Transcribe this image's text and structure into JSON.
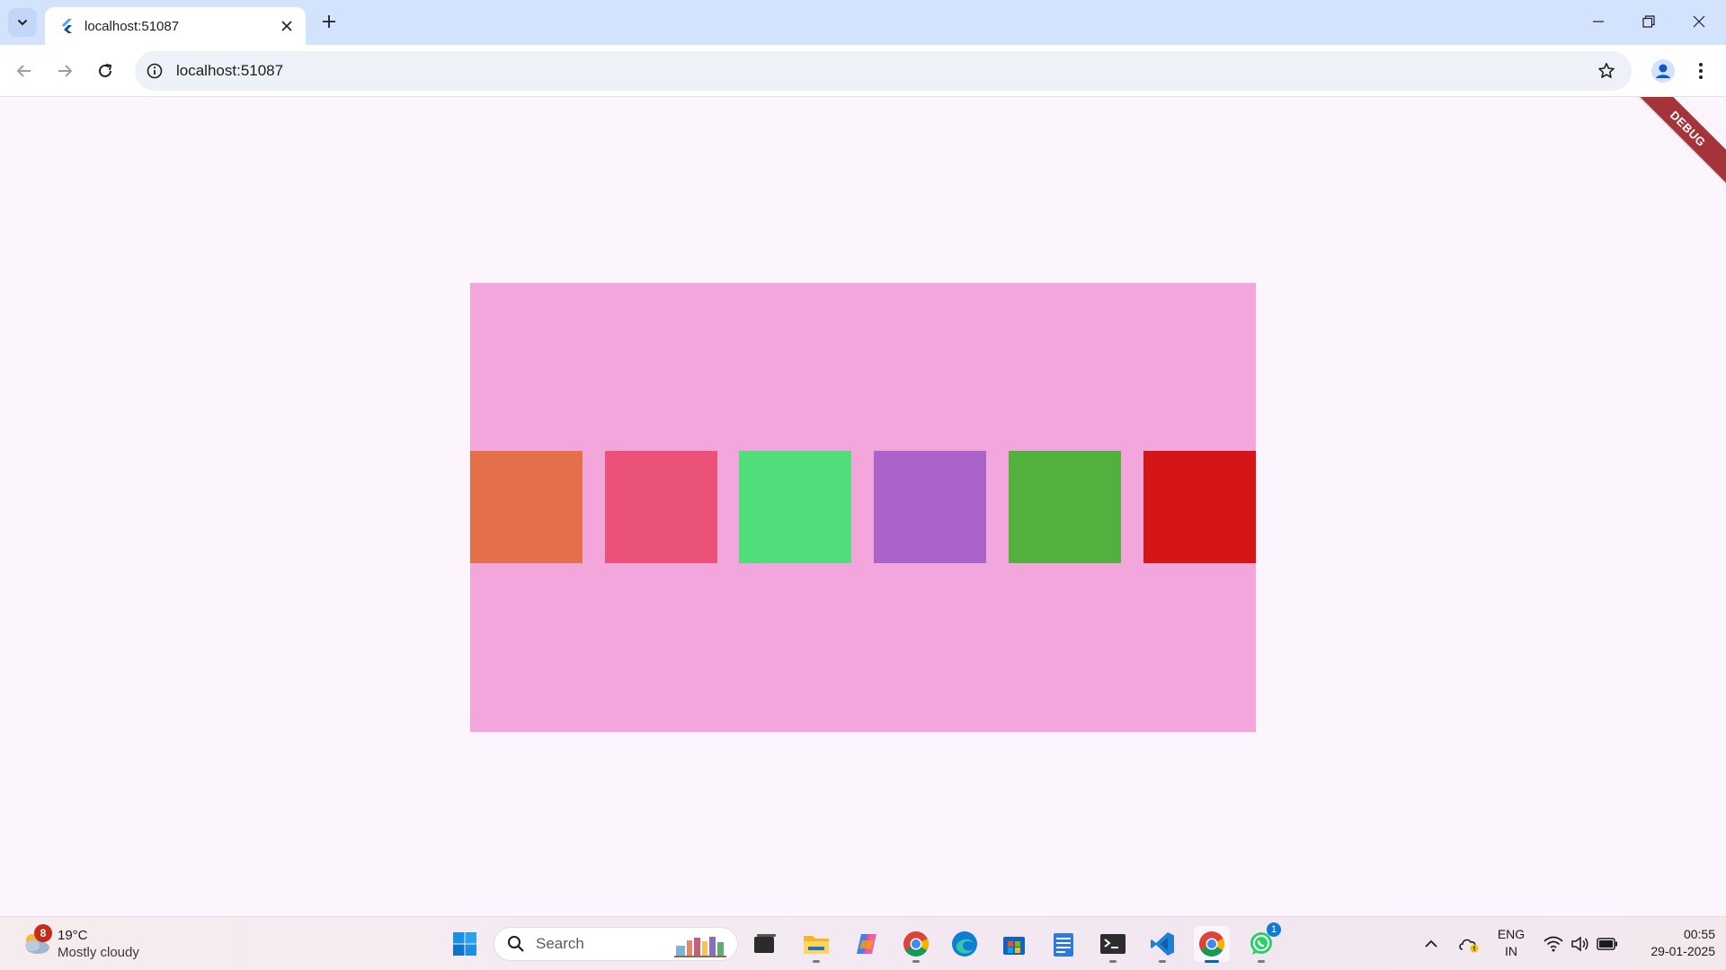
{
  "browser": {
    "tab_title": "localhost:51087",
    "url": "localhost:51087"
  },
  "app": {
    "debug_banner": "DEBUG",
    "container_color": "#f3a6dc",
    "squares": [
      {
        "color": "#e37048"
      },
      {
        "color": "#ea5277"
      },
      {
        "color": "#51de7a"
      },
      {
        "color": "#a963cb"
      },
      {
        "color": "#52b03c"
      },
      {
        "color": "#d41518"
      }
    ]
  },
  "taskbar": {
    "weather": {
      "badge": "8",
      "temp": "19°C",
      "desc": "Mostly cloudy"
    },
    "search_label": "Search",
    "apps": [
      "start-icon",
      "search-widgets-icon",
      "task-view-icon",
      "file-explorer-icon",
      "copilot-icon",
      "chrome-icon",
      "edge-icon",
      "store-icon",
      "notepad-icon",
      "terminal-icon",
      "vscode-icon",
      "chrome-active-icon",
      "whatsapp-icon"
    ],
    "whatsapp_badge": "1",
    "tray": {
      "lang_line1": "ENG",
      "lang_line2": "IN",
      "time": "00:55",
      "date": "29-01-2025"
    }
  }
}
